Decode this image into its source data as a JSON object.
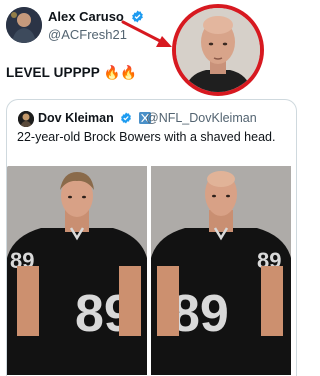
{
  "tweet": {
    "author_name": "Alex Caruso",
    "author_handle": "@ACFresh21",
    "text": "LEVEL UPPPP 🔥🔥"
  },
  "quote": {
    "author_name": "Dov Kleiman",
    "author_handle": "@NFL_DovKleiman",
    "text": "22-year-old Brock Bowers with a shaved head."
  },
  "colors": {
    "verified": "#1d9bf0",
    "arrow": "#d71920",
    "jersey": "#121212",
    "skin": "#d9a98a"
  },
  "icons": [
    "verified-badge-icon",
    "x-logo-icon",
    "fire-emoji-icon"
  ]
}
